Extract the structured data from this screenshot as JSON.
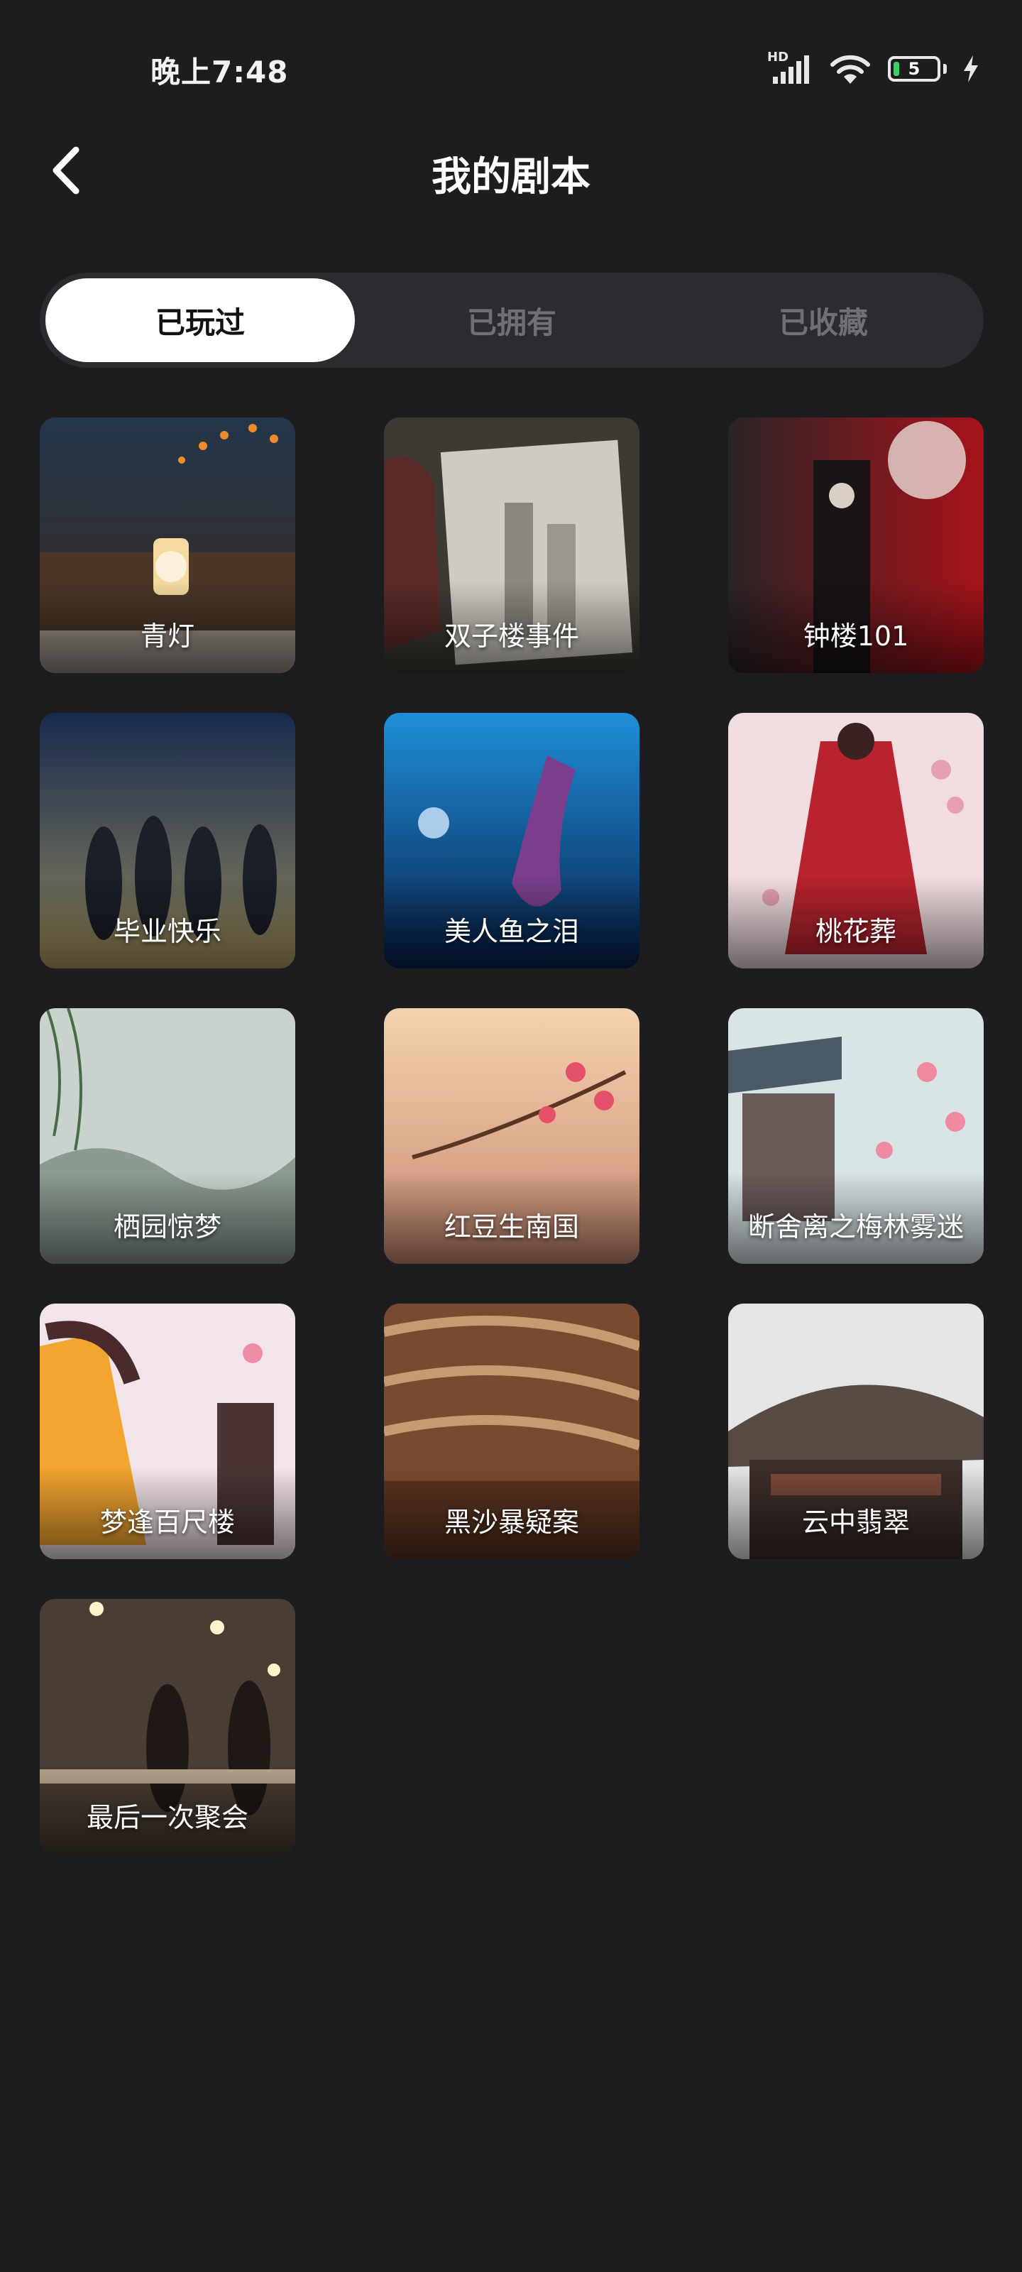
{
  "status_bar": {
    "time": "晚上7:48",
    "network_label": "HD",
    "battery_level": "5",
    "icons": [
      "hd-signal-icon",
      "wifi-icon",
      "battery-icon",
      "charging-bolt-icon"
    ]
  },
  "header": {
    "title": "我的剧本",
    "back_icon": "chevron-left-icon"
  },
  "tabs": [
    {
      "label": "已玩过",
      "active": true
    },
    {
      "label": "已拥有",
      "active": false
    },
    {
      "label": "已收藏",
      "active": false
    }
  ],
  "scripts": [
    {
      "title": "青灯"
    },
    {
      "title": "双子楼事件"
    },
    {
      "title": "钟楼101"
    },
    {
      "title": "毕业快乐"
    },
    {
      "title": "美人鱼之泪"
    },
    {
      "title": "桃花葬"
    },
    {
      "title": "栖园惊梦"
    },
    {
      "title": "红豆生南国"
    },
    {
      "title": "断舍离之梅林雾迷"
    },
    {
      "title": "梦逢百尺楼"
    },
    {
      "title": "黑沙暴疑案"
    },
    {
      "title": "云中翡翠"
    },
    {
      "title": "最后一次聚会"
    }
  ],
  "colors": {
    "background": "#1d1d20",
    "tab_track": "#2c2c30",
    "tab_active_bg": "#ffffff",
    "tab_inactive_text": "#6f6f74",
    "battery_green": "#3ad15c"
  }
}
